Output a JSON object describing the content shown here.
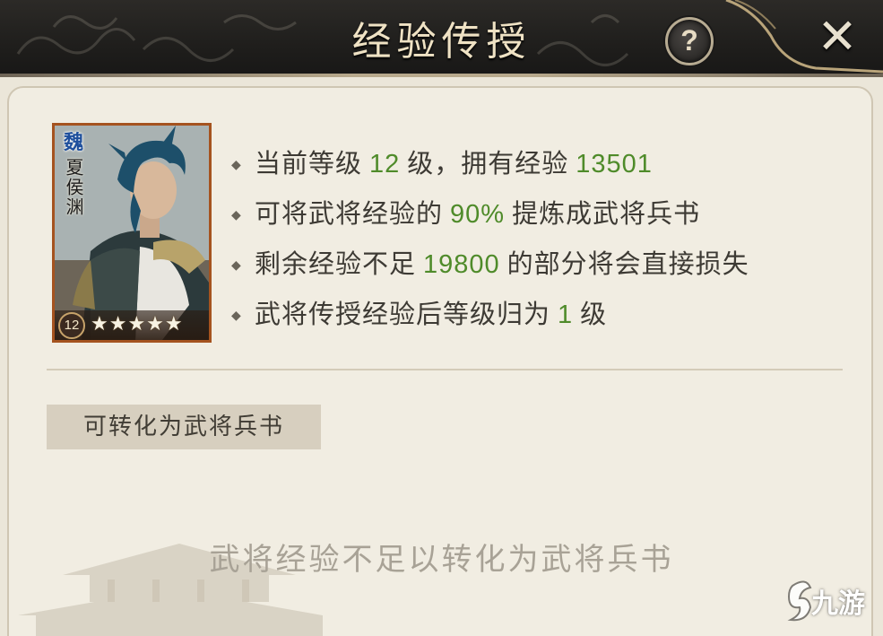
{
  "header": {
    "title": "经验传授",
    "help_label": "?",
    "close_label": "✕"
  },
  "hero_card": {
    "faction": "魏",
    "name": "夏侯渊",
    "level": "12",
    "stars": "★★★★★",
    "star_count": 5
  },
  "info_lines": [
    {
      "prefix": "当前等级",
      "value": "12",
      "suffix": "级，拥有经验",
      "value2": "13501",
      "suffix2": ""
    },
    {
      "prefix": "可将武将经验的",
      "value": "90%",
      "suffix": "提炼成武将兵书",
      "value2": "",
      "suffix2": ""
    },
    {
      "prefix": "剩余经验不足",
      "value": "19800",
      "suffix": "的部分将会直接损失",
      "value2": "",
      "suffix2": ""
    },
    {
      "prefix": "武将传授经验后等级归为",
      "value": "1",
      "suffix": "级",
      "value2": "",
      "suffix2": ""
    }
  ],
  "section": {
    "label": "可转化为武将兵书",
    "empty_message": "武将经验不足以转化为武将兵书"
  },
  "watermark": {
    "text": "九游"
  },
  "colors": {
    "highlight": "#4f8b2a",
    "header_bg": "#1f1e1c",
    "panel_bg": "#f1ede2",
    "card_border": "#a5531f"
  }
}
